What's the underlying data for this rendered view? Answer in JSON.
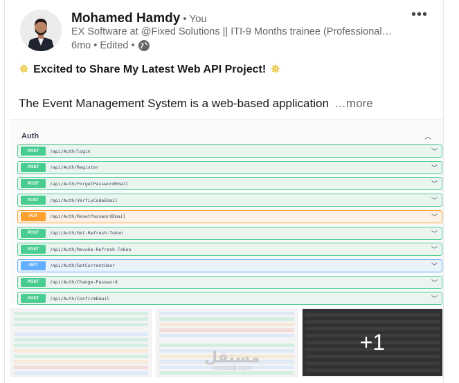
{
  "author": {
    "name": "Mohamed Hamdy",
    "relation": "• You",
    "headline": "EX Software at @Fixed Solutions || ITI-9 Months trainee (Professional…",
    "time": "6mo • Edited •"
  },
  "post": {
    "title": "Excited to Share My Latest Web API Project!",
    "body": "The Event Management System is a web-based application",
    "see_more": "…more"
  },
  "swagger": {
    "section": "Auth",
    "operations": [
      {
        "method": "POST",
        "path": "/api/Auth/login"
      },
      {
        "method": "POST",
        "path": "/api/Auth/Register"
      },
      {
        "method": "POST",
        "path": "/api/Auth/ForgetPasswordEmail"
      },
      {
        "method": "POST",
        "path": "/api/Auth/VerfiyCodeEmail"
      },
      {
        "method": "PUT",
        "path": "/api/Auth/ResetPasswordEmail"
      },
      {
        "method": "POST",
        "path": "/api/Auth/Get-Refresh-Token"
      },
      {
        "method": "POST",
        "path": "/api/Auth/Revoke-Refresh-Token"
      },
      {
        "method": "GET",
        "path": "/api/Auth/GetCurrentUser"
      },
      {
        "method": "POST",
        "path": "/api/Auth/Change-Password"
      },
      {
        "method": "POST",
        "path": "/api/Auth/ConfirmEmail"
      }
    ]
  },
  "thumbnails": {
    "more_count": "+1"
  },
  "watermark": {
    "arabic": "مستقل",
    "latin": "mostaql.com"
  },
  "icons": {
    "menu": "more-horizontal-icon",
    "visibility": "globe-icon",
    "sparkle": "star-burst-icon",
    "expand": "chevron-down-icon",
    "collapse": "chevron-up-icon"
  },
  "colors": {
    "post_method": "#49cc90",
    "put_method": "#fca130",
    "get_method": "#61affe"
  }
}
